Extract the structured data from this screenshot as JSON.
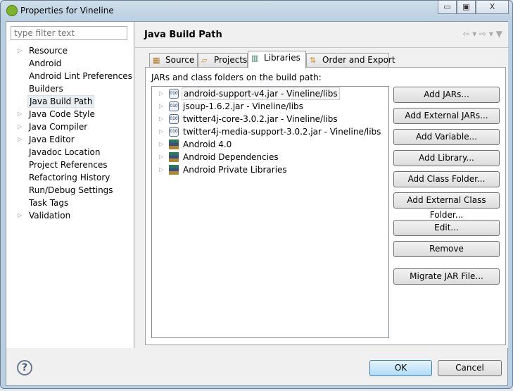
{
  "window": {
    "title": "Properties for Vineline",
    "minimize": "▭",
    "maximize": "▣",
    "close": "X"
  },
  "sidebar": {
    "filter_placeholder": "type filter text",
    "items": [
      {
        "label": "Resource",
        "expandable": true
      },
      {
        "label": "Android",
        "expandable": false
      },
      {
        "label": "Android Lint Preferences",
        "expandable": false
      },
      {
        "label": "Builders",
        "expandable": false
      },
      {
        "label": "Java Build Path",
        "expandable": false,
        "selected": true
      },
      {
        "label": "Java Code Style",
        "expandable": true
      },
      {
        "label": "Java Compiler",
        "expandable": true
      },
      {
        "label": "Java Editor",
        "expandable": true
      },
      {
        "label": "Javadoc Location",
        "expandable": false
      },
      {
        "label": "Project References",
        "expandable": false
      },
      {
        "label": "Refactoring History",
        "expandable": false
      },
      {
        "label": "Run/Debug Settings",
        "expandable": false
      },
      {
        "label": "Task Tags",
        "expandable": false
      },
      {
        "label": "Validation",
        "expandable": true
      }
    ]
  },
  "page": {
    "title": "Java Build Path",
    "nav": "⇦ ▾ ⇨ ▾ ▼",
    "tabs": [
      {
        "label": "Source",
        "icon": "source-folder-icon"
      },
      {
        "label": "Projects",
        "icon": "projects-folder-icon"
      },
      {
        "label": "Libraries",
        "icon": "libraries-icon",
        "active": true
      },
      {
        "label": "Order and Export",
        "icon": "order-export-icon"
      }
    ],
    "list_label": "JARs and class folders on the build path:",
    "entries": [
      {
        "label": "android-support-v4.jar - Vineline/libs",
        "type": "jar",
        "selected": true
      },
      {
        "label": "jsoup-1.6.2.jar - Vineline/libs",
        "type": "jar"
      },
      {
        "label": "twitter4j-core-3.0.2.jar - Vineline/libs",
        "type": "jar"
      },
      {
        "label": "twitter4j-media-support-3.0.2.jar - Vineline/libs",
        "type": "jar"
      },
      {
        "label": "Android 4.0",
        "type": "library"
      },
      {
        "label": "Android Dependencies",
        "type": "library"
      },
      {
        "label": "Android Private Libraries",
        "type": "library"
      }
    ],
    "buttons": [
      "Add JARs...",
      "Add External JARs...",
      "Add Variable...",
      "Add Library...",
      "Add Class Folder...",
      "Add External Class Folder...",
      "Edit...",
      "Remove",
      "Migrate JAR File..."
    ]
  },
  "footer": {
    "help": "?",
    "ok": "OK",
    "cancel": "Cancel"
  }
}
